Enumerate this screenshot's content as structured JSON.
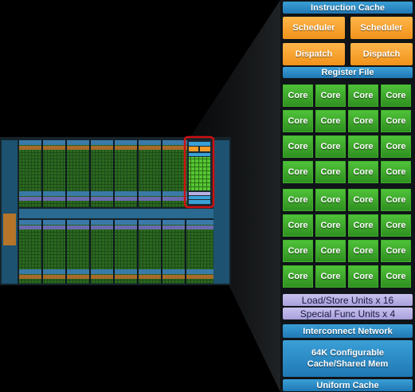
{
  "sm_detail": {
    "instruction_cache": "Instruction Cache",
    "schedulers": [
      "Scheduler",
      "Scheduler"
    ],
    "dispatch_units": [
      "Dispatch",
      "Dispatch"
    ],
    "register_file": "Register File",
    "core_label": "Core",
    "core_rows": 8,
    "cores_per_row": 4,
    "load_store": "Load/Store Units x 16",
    "special_func": "Special Func Units x 4",
    "interconnect": "Interconnect Network",
    "shared_mem_line1": "64K Configurable",
    "shared_mem_line2": "Cache/Shared Mem",
    "uniform_cache": "Uniform Cache"
  },
  "colors": {
    "core_green": "#3fae2b",
    "scheduler_orange": "#f7a12c",
    "bar_blue": "#2e8fcf",
    "func_purple": "#b8b0e6",
    "highlight_red": "#d01010"
  }
}
